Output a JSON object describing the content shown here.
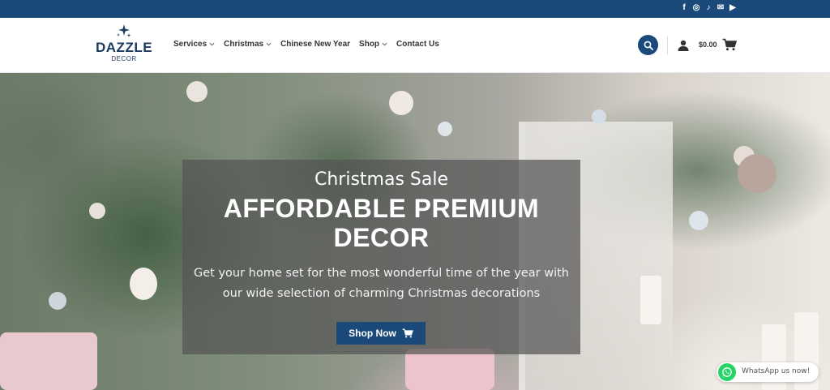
{
  "topbar": {
    "socials": [
      {
        "icon": "facebook-icon",
        "glyph": "f"
      },
      {
        "icon": "instagram-icon",
        "glyph": "◎"
      },
      {
        "icon": "tiktok-icon",
        "glyph": "♪"
      },
      {
        "icon": "email-icon",
        "glyph": "✉"
      },
      {
        "icon": "youtube-icon",
        "glyph": "▶"
      }
    ]
  },
  "logo": {
    "name": "DAZZLE",
    "sub": "DECOR"
  },
  "nav": [
    {
      "label": "Services",
      "dropdown": true
    },
    {
      "label": "Christmas",
      "dropdown": true
    },
    {
      "label": "Chinese New Year",
      "dropdown": false
    },
    {
      "label": "Shop",
      "dropdown": true
    },
    {
      "label": "Contact Us",
      "dropdown": false
    }
  ],
  "cart": {
    "total": "$0.00"
  },
  "hero": {
    "kicker": "Christmas Sale",
    "title": "AFFORDABLE PREMIUM DECOR",
    "text": "Get your home set for the most wonderful time of the year with our wide selection of charming Christmas decorations",
    "button_label": "Shop Now"
  },
  "whatsapp": {
    "label": "WhatsApp us now!"
  },
  "colors": {
    "brand": "#1b4a7a",
    "whatsapp": "#25d366"
  }
}
